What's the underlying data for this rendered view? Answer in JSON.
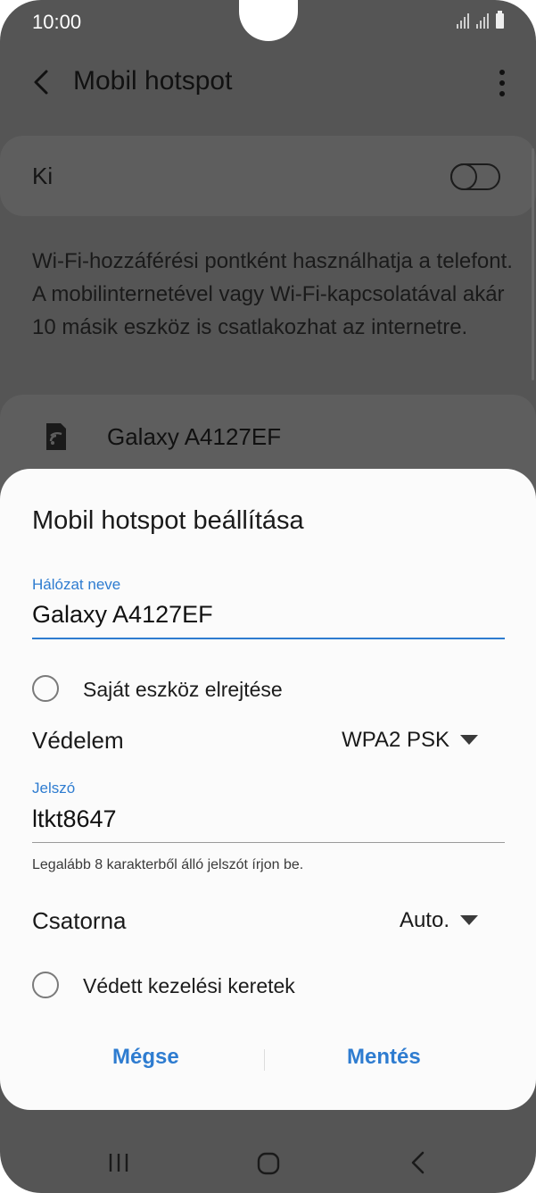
{
  "status_bar": {
    "time": "10:00"
  },
  "app_bar": {
    "title": "Mobil hotspot",
    "back_icon": "chevron-left-icon",
    "more_icon": "more-vertical-icon"
  },
  "toggle_row": {
    "label": "Ki",
    "state": "off"
  },
  "description": "Wi-Fi-hozzáférési pontként használhatja a telefont. A mobilinternetével vagy Wi-Fi-kapcsolatával akár 10 másik eszköz is csatlakozhat az internetre.",
  "hotspot": {
    "name": "Galaxy A4127EF",
    "icon": "hotspot-icon"
  },
  "dialog": {
    "title": "Mobil hotspot beállítása",
    "network_name_label": "Hálózat neve",
    "network_name_value": "Galaxy A4127EF",
    "hide_device_label": "Saját eszköz elrejtése",
    "security_label": "Védelem",
    "security_value": "WPA2 PSK",
    "password_label": "Jelszó",
    "password_value": "ltkt8647",
    "password_hint": "Legalább 8 karakterből álló jelszót írjon be.",
    "channel_label": "Csatorna",
    "channel_value": "Auto.",
    "protected_frames_label": "Védett kezelési keretek",
    "cancel_label": "Mégse",
    "save_label": "Mentés"
  },
  "colors": {
    "accent": "#2e7cd0",
    "dim_background": "#555555",
    "sheet": "#fbfbfb"
  }
}
